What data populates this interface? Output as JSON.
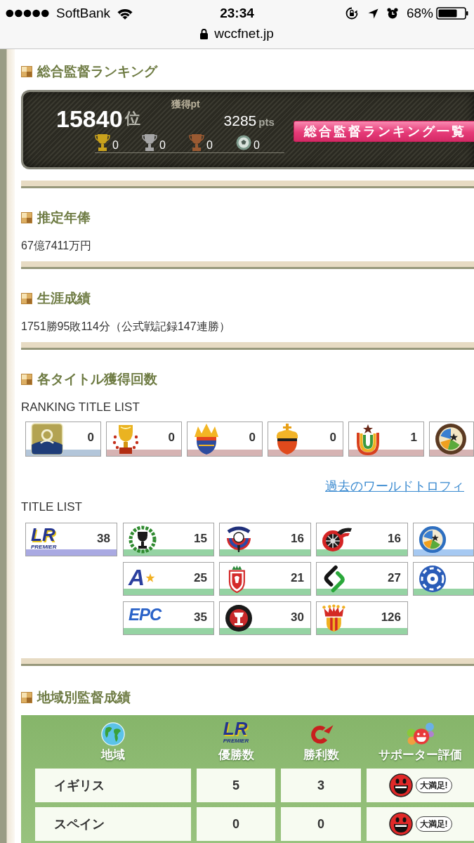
{
  "status_bar": {
    "carrier": "SoftBank",
    "time": "23:34",
    "battery": "68%",
    "url": "wccfnet.jp"
  },
  "ranking": {
    "title": "総合監督ランキング",
    "rank": "15840",
    "rank_unit": "位",
    "points_label": "獲得pt",
    "points": "3285",
    "points_unit": "pts",
    "trophies": [
      {
        "kind": "trophy",
        "color": "#c9a21c",
        "count": "0"
      },
      {
        "kind": "trophy",
        "color": "#a6a6a6",
        "count": "0"
      },
      {
        "kind": "trophy",
        "color": "#9a5a32",
        "count": "0"
      },
      {
        "kind": "ball",
        "color": "#7d9a8c",
        "count": "0"
      }
    ],
    "button": "総合監督ランキング一覧"
  },
  "salary": {
    "title": "推定年俸",
    "value": "67億7411万円"
  },
  "career": {
    "title": "生涯成績",
    "value": "1751勝95敗114分（公式戦記録147連勝）"
  },
  "titles": {
    "title": "各タイトル獲得回数",
    "ranking_label": "RANKING TITLE LIST",
    "ranking_titles": [
      {
        "kind": "badge",
        "count": "0",
        "color": "#b3c6da"
      },
      {
        "kind": "trophy",
        "count": "0",
        "color": "#d6b3b3"
      },
      {
        "kind": "sunburst",
        "count": "0",
        "color": "#d6b3b3"
      },
      {
        "kind": "crown",
        "count": "0",
        "color": "#d6b3b3"
      },
      {
        "kind": "rainbow",
        "count": "1",
        "color": "#d6b3b3"
      },
      {
        "kind": "ring",
        "color": "#d6b3b3"
      }
    ],
    "link": "過去のワールドトロフィ",
    "title_label": "TITLE LIST",
    "league_title": {
      "kind": "wordmark",
      "logo_text": "LR",
      "logo_caption": "PREMIER",
      "count": "38",
      "color": "#a9a9e2"
    },
    "title_list": [
      {
        "kind": "wreath",
        "count": "15",
        "color": "#95d3a3"
      },
      {
        "kind": "ballcrest",
        "count": "16",
        "color": "#95d3a3"
      },
      {
        "kind": "wheel",
        "count": "16",
        "color": "#95d3a3"
      },
      {
        "kind": "bluering",
        "color": "#a6c9f2"
      },
      {
        "kind": "letter",
        "logo_text": "A",
        "count": "25",
        "color": "#95d3a3"
      },
      {
        "kind": "shield",
        "count": "21",
        "color": "#95d3a3"
      },
      {
        "kind": "links",
        "count": "27",
        "color": "#95d3a3"
      },
      {
        "kind": "swirl",
        "color": "#95d3a3"
      },
      {
        "kind": "text",
        "logo_text": "EPC",
        "count": "35",
        "color": "#95d3a3"
      },
      {
        "kind": "disc",
        "count": "30",
        "color": "#95d3a3"
      },
      {
        "kind": "coronet",
        "count": "126",
        "color": "#95d3a3"
      }
    ]
  },
  "regions": {
    "title": "地域別監督成績",
    "columns": [
      {
        "label": "地域",
        "kind": "globe"
      },
      {
        "label": "優勝数",
        "kind": "wordmark",
        "logo_text": "LR",
        "logo_caption": "PREMIER"
      },
      {
        "label": "勝利数",
        "kind": "swoosh"
      },
      {
        "label": "サポーター評価",
        "kind": "faces"
      }
    ],
    "rows": [
      {
        "region": "イギリス",
        "titles": "5",
        "wins": "3",
        "rating": "大満足!"
      },
      {
        "region": "スペイン",
        "titles": "0",
        "wins": "0",
        "rating": "大満足!"
      }
    ]
  }
}
